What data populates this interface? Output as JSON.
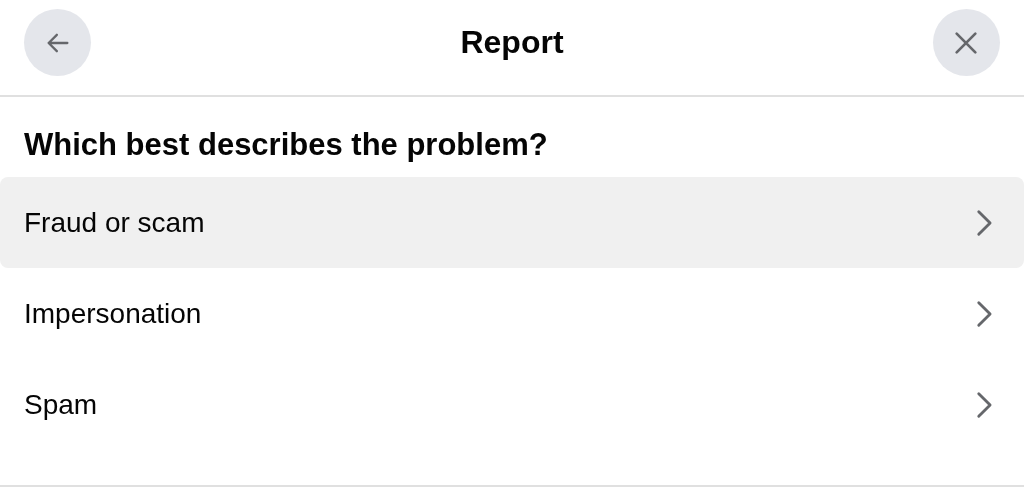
{
  "header": {
    "title": "Report"
  },
  "question": "Which best describes the problem?",
  "options": [
    {
      "label": "Fraud or scam",
      "selected": true
    },
    {
      "label": "Impersonation",
      "selected": false
    },
    {
      "label": "Spam",
      "selected": false
    }
  ]
}
